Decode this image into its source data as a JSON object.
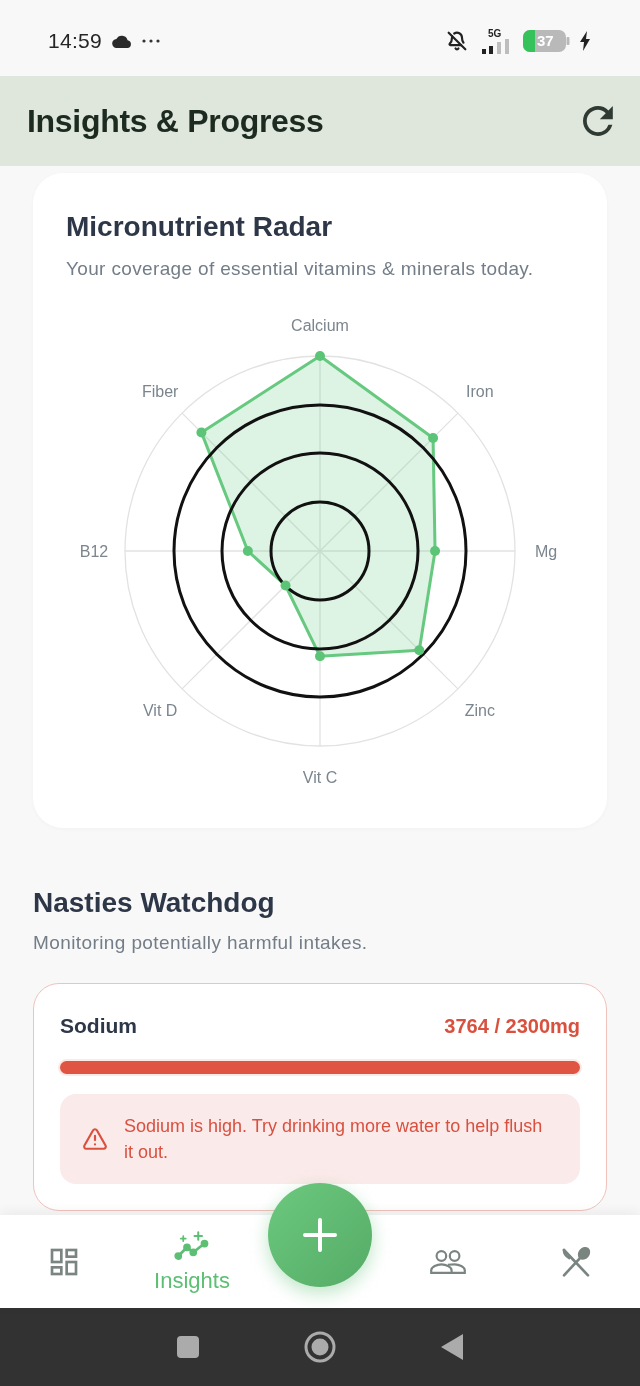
{
  "status_bar": {
    "time": "14:59",
    "network": "5G",
    "battery": "37"
  },
  "header": {
    "title": "Insights & Progress"
  },
  "radar_card": {
    "title": "Micronutrient Radar",
    "subtitle": "Your coverage of essential vitamins & minerals today.",
    "axes": [
      "Calcium",
      "Iron",
      "Mg",
      "Zinc",
      "Vit C",
      "Vit D",
      "B12",
      "Fiber"
    ]
  },
  "nasties": {
    "title": "Nasties Watchdog",
    "subtitle": "Monitoring potentially harmful intakes.",
    "items": [
      {
        "name": "Sodium",
        "reading": "3764 / 2300mg",
        "level": 1,
        "alert": "Sodium is high. Try drinking more water to help flush it out."
      }
    ]
  },
  "nav": {
    "items": [
      {
        "selected": false
      },
      {
        "label": "Insights",
        "selected": true
      },
      {
        "selected": false
      },
      {
        "selected": false
      }
    ]
  }
}
